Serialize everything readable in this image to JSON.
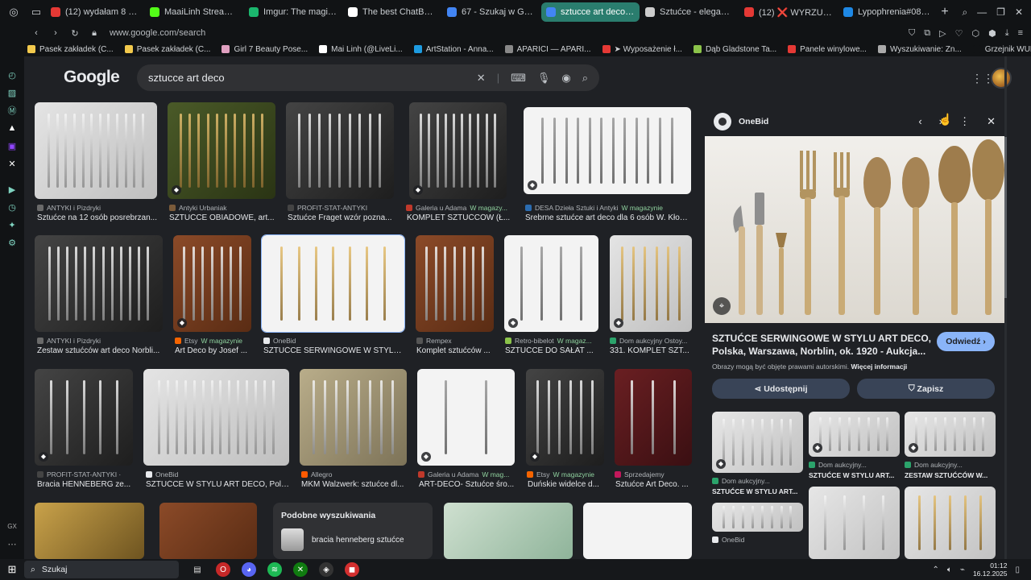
{
  "tabs": [
    {
      "title": "(12) wydałam 8 tysięcy",
      "color": "#e53935"
    },
    {
      "title": "MaaiLinh Stream - Kick",
      "color": "#53fc18"
    },
    {
      "title": "Imgur: The magic of the",
      "color": "#1bb76e"
    },
    {
      "title": "The best ChatBot and W",
      "color": "#ffffff"
    },
    {
      "title": "67 - Szukaj w Google",
      "color": "#4285f4"
    },
    {
      "title": "sztucce art deco - Szuka",
      "color": "#4285f4",
      "active": true
    },
    {
      "title": "Sztućce - eleganckie, n",
      "color": "#cccccc"
    },
    {
      "title": "(12) ❌ WYRZUĆ TO! 10",
      "color": "#e53935"
    },
    {
      "title": "Lypophrenia#0831 (EUW",
      "color": "#1e88e5"
    }
  ],
  "address": {
    "url": "www.google.com/search"
  },
  "bookmarks": [
    {
      "label": "Pasek zakładek (C...",
      "color": "#f2c94c"
    },
    {
      "label": "Pasek zakładek (C...",
      "color": "#f2c94c"
    },
    {
      "label": "Girl 7 Beauty Pose...",
      "color": "#e0a0c0"
    },
    {
      "label": "Mai Linh (@LiveLi...",
      "color": "#ffffff"
    },
    {
      "label": "ArtStation - Anna...",
      "color": "#1d9be0"
    },
    {
      "label": "APARICI — APARI...",
      "color": "#888888"
    },
    {
      "label": "➤ Wyposażenie ł...",
      "color": "#e53935"
    },
    {
      "label": "Dąb Gladstone Ta...",
      "color": "#8bc34a"
    },
    {
      "label": "Panele winylowe...",
      "color": "#e53935"
    },
    {
      "label": "Wyszukiwanie: Zn...",
      "color": "#aaaaaa"
    },
    {
      "label": "Grzejnik WULKAN...",
      "color": "#111315"
    }
  ],
  "google": {
    "logo": "Google",
    "query": "sztucce art deco"
  },
  "results": [
    {
      "source": "ANTYKI i Pizdryki",
      "title": "Sztućce na 12 osób posrebrzan...",
      "mag": ""
    },
    {
      "source": "Antyki Urbaniak",
      "title": "SZTUĆCE OBIADOWE, art...",
      "mag": ""
    },
    {
      "source": "PROFIT-STAT-ANTYKI",
      "title": "Sztućce Fraget wzór pozna...",
      "mag": ""
    },
    {
      "source": "Galeria u Adama",
      "title": "KOMPLET SZTUĆCÓW (Ł...",
      "mag": "W magazy..."
    },
    {
      "source": "DESA Dzieła Sztuki i Antyki",
      "title": "Srebrne sztućce art deco dla 6 osób W. Kłodo...",
      "mag": "W magazynie"
    },
    {
      "source": "ANTYKI i Pizdryki",
      "title": "Zestaw sztućców art deco Norbli...",
      "mag": ""
    },
    {
      "source": "Etsy",
      "title": "Art Deco by Josef ...",
      "mag": "W magazynie"
    },
    {
      "source": "OneBid",
      "title": "SZTUĆCE SERWINGOWE W STYLU...",
      "mag": ""
    },
    {
      "source": "Rempex",
      "title": "Komplet sztućców ...",
      "mag": ""
    },
    {
      "source": "Retro-bibelot",
      "title": "SZTUĆCE DO SAŁAT ...",
      "mag": "W magaz..."
    },
    {
      "source": "Dom aukcyjny Ostoy...",
      "title": "331. KOMPLET SZT...",
      "mag": ""
    },
    {
      "source": "PROFIT-STAT-ANTYKI ·",
      "title": "Bracia HENNEBERG ze...",
      "mag": ""
    },
    {
      "source": "OneBid",
      "title": "SZTUĆCE W STYLU ART DECO, Pols...",
      "mag": ""
    },
    {
      "source": "Allegro",
      "title": "MKM Walzwerk: sztućce dl...",
      "mag": ""
    },
    {
      "source": "Galeria u Adama",
      "title": "ART-DECO- Sztućce śro...",
      "mag": "W mag..."
    },
    {
      "source": "Etsy",
      "title": "Duńskie widelce d...",
      "mag": "W magazynie"
    },
    {
      "source": "Sprzedajemy",
      "title": "Sztućce Art Deco. ...",
      "mag": ""
    }
  ],
  "similar": {
    "heading": "Podobne wyszukiwania",
    "item": "bracia henneberg sztućce"
  },
  "panel": {
    "site": "OneBid",
    "title": "SZTUĆCE SERWINGOWE W STYLU ART DECO, Polska, Warszawa, Norblin, ok. 1920 - Aukcja...",
    "visit": "Odwiedź",
    "rights": "Obrazy mogą być objęte prawami autorskimi.",
    "rights_link": "Więcej informacji",
    "share": "Udostępnij",
    "save": "Zapisz",
    "related": [
      {
        "source": "Dom aukcyjny...",
        "title": "SZTUĆCE W STYLU ART..."
      },
      {
        "source": "Dom aukcyjny...",
        "title": "ZESTAW SZTUĆCÓW W..."
      },
      {
        "source": "Dom aukcyjny...",
        "title": "SZTUĆCE W STYLU ART..."
      },
      {
        "source": "OneBid",
        "title": ""
      }
    ]
  },
  "taskbar": {
    "search": "Szukaj",
    "time": "01:12",
    "date": "16.12.2025"
  }
}
